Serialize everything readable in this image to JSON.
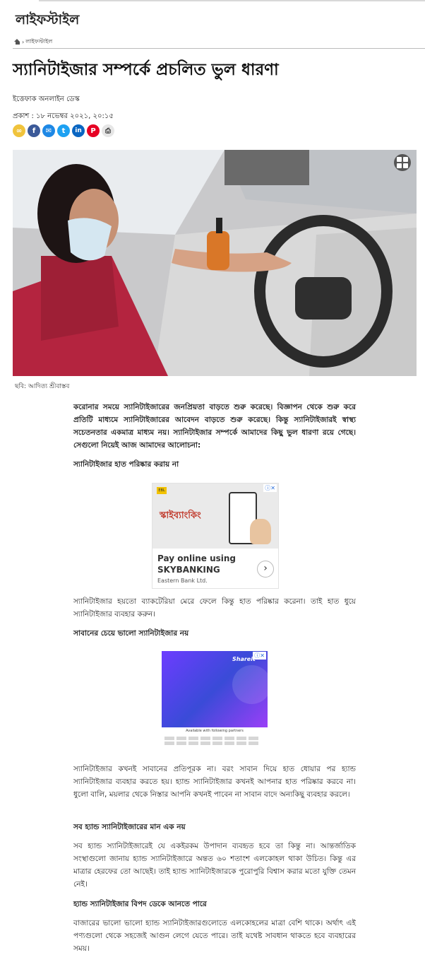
{
  "section": {
    "title": "লাইফস্টাইল"
  },
  "breadcrumb": {
    "current": "লাইফস্টাইল"
  },
  "article": {
    "headline": "স্যানিটাইজার সম্পর্কে প্রচলিত ভুল ধারণা",
    "author": "ইত্তেফাক অনলাইন ডেস্ক",
    "published": "প্রকাশ : ১৮ নভেম্বর ২০২১, ২০:১৫",
    "image_caption": "ছবি: আদিত্য শ্রীবাস্তব",
    "paragraphs": [
      "করোনার সময়ে স্যানিটাইজারের জনপ্রিয়তা বাড়তে শুরু করেছে। বিজ্ঞাপন থেকে শুরু করে প্রতিটি মাধ্যমে স্যানিটাইজারের আবেদন বাড়তে শুরু করেছে। কিন্তু স্যানিটাইজারই স্বাস্থ্য সচেতনতার একমাত্র মাধ্যম নয়। স্যানিটাইজার সম্পর্কে আমাদের কিছু ভুল ধারণা রয়ে গেছে। সেগুলো নিয়েই আজ আমাদের আলোচনা:",
      "স্যানিটাইজার হাত পরিষ্কার করায় না",
      "স্যানিটাইজার হয়তো ব্যাকটেরিয়া মেরে ফেলে কিন্তু হাত পরিষ্কার করেনা। তাই হাত ধুয়ে স্যানিটাইজার ব্যবহার করুন।",
      "সাবানের চেয়ে ভালো স্যানিটাইজার নয়",
      "স্যানিটাইজার কখনই সাবানের প্রতিপূরক না। বরং সাবান দিয়ে হাত ধোয়ার পর হ্যান্ড স্যানিটাইজার ব্যবহার করতে হয়। হ্যান্ড স্যানিটাইজার কখনই আপনার হাত পরিষ্কার করবে না। ধুলো বালি, ময়লার থেকে নিস্তার আপনি কখনই পাবেন না সাবান বাদে অন্যকিছু ব্যবহার করলে।",
      "সব হ্যান্ড স্যানিটাইজারের মান এক নয়",
      "সব হ্যান্ড স্যানিটাইজারেই যে একইরকম উপাদান ব্যবহৃত হবে তা কিন্তু না। আন্তর্জাতিক সংস্থাগুলো জানায় হ্যান্ড স্যানিটাইজারে অন্তত ৬০ শতাংশ এলকোহল থাকা উচিত। কিন্তু এর মাত্রার হেরফের তো আছেই। তাই হ্যান্ড স্যানিটাইজারকে পুরোপুরি বিশ্বাস করার মতো যুক্তি তেমন নেই।",
      "হ্যান্ড স্যানিটাইজার বিপদ ডেকে আনতে পারে",
      "বাজারের ভালো ভালো হ্যান্ড স্যানিটাইজারগুলোতে এলকোহলের মাত্রা বেশি থাকে। অর্থাৎ এই পণ্যগুলো থেকে সহজেই আগুন লেগে যেতে পারে। তাই যথেষ্ট সাবধান থাকতে হবে ব্যবহারের সময়।"
    ]
  },
  "share": {
    "icons": [
      "link-icon",
      "facebook-icon",
      "messenger-icon",
      "twitter-icon",
      "linkedin-icon",
      "pinterest-icon",
      "print-icon"
    ]
  },
  "ads": {
    "bank": {
      "tagline": "স্কাইব্যাংকিং",
      "headline_line1": "Pay online using",
      "headline_line2": "SKYBANKING",
      "sponsor": "Eastern Bank Ltd."
    },
    "shareit": {
      "brand": "Shareit",
      "available": "Available with following partners"
    },
    "close_glyph": "ⓘ✕"
  },
  "colors": {
    "link": "#f0c33c",
    "facebook": "#3b5998",
    "messenger": "#1e88e5",
    "twitter": "#1da1f2",
    "linkedin": "#0a66c2",
    "pinterest": "#e60023"
  }
}
